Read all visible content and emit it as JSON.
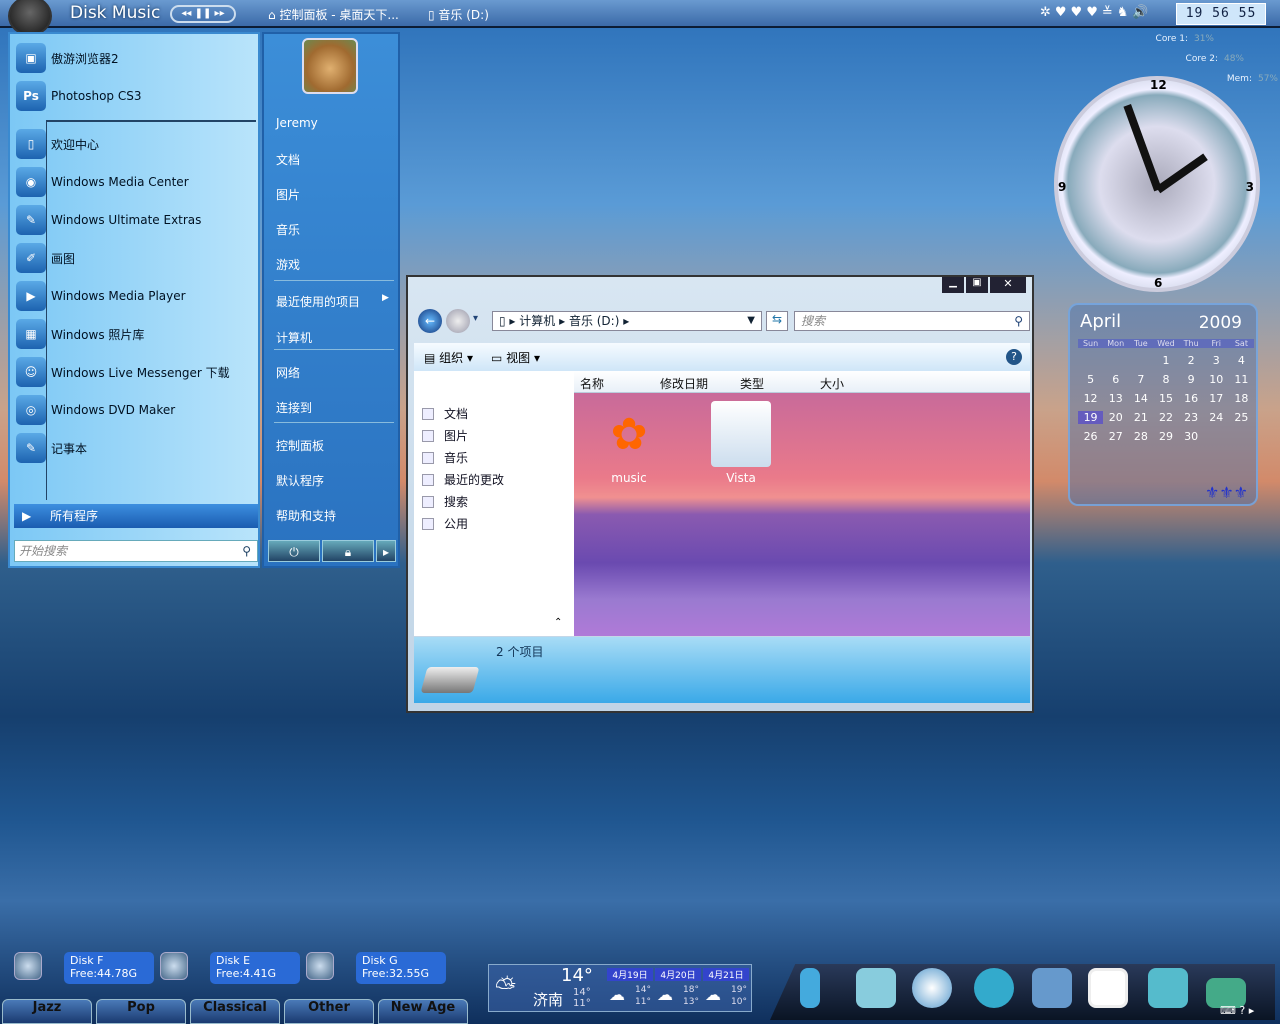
{
  "topbar": {
    "app_name": "Disk  Music",
    "media_controls": "◂◂ ❚❚ ▸▸",
    "tasks": [
      "控制面板 - 桌面天下...",
      "音乐 (D:)"
    ],
    "time": "19 56 55"
  },
  "meters": [
    {
      "label": "Core 1:",
      "value": "31%"
    },
    {
      "label": "Core 2:",
      "value": "48%"
    },
    {
      "label": "Mem:",
      "value": "57%"
    }
  ],
  "start_menu": {
    "pinned": [
      {
        "label": "傲游浏览器2",
        "icon": "browser-icon",
        "glyph": "▣"
      },
      {
        "label": "Photoshop CS3",
        "icon": "photoshop-icon",
        "glyph": "Ps"
      }
    ],
    "recent": [
      {
        "label": "欢迎中心",
        "glyph": "▯"
      },
      {
        "label": "Windows Media Center",
        "glyph": "◉"
      },
      {
        "label": "Windows Ultimate Extras",
        "glyph": "✎"
      },
      {
        "label": "画图",
        "glyph": "✐"
      },
      {
        "label": "Windows Media Player",
        "glyph": "▶"
      },
      {
        "label": "Windows 照片库",
        "glyph": "▦"
      },
      {
        "label": "Windows Live Messenger 下载",
        "glyph": "☺"
      },
      {
        "label": "Windows DVD Maker",
        "glyph": "◎"
      },
      {
        "label": "记事本",
        "glyph": "✎"
      }
    ],
    "all_programs": "所有程序",
    "search_placeholder": "开始搜索",
    "right": [
      "Jeremy",
      "文档",
      "图片",
      "音乐",
      "游戏",
      "最近使用的项目",
      "计算机",
      "网络",
      "连接到",
      "控制面板",
      "默认程序",
      "帮助和支持"
    ]
  },
  "explorer": {
    "breadcrumb": [
      "计算机",
      "音乐 (D:)"
    ],
    "search_placeholder": "搜索",
    "toolbar": [
      "组织",
      "视图"
    ],
    "nav": [
      "文档",
      "图片",
      "音乐",
      "最近的更改",
      "搜索",
      "公用"
    ],
    "columns": [
      "名称",
      "修改日期",
      "类型",
      "大小"
    ],
    "files": [
      "music",
      "Vista"
    ],
    "status": "2 个项目"
  },
  "calendar": {
    "month": "April",
    "year": "2009",
    "weekdays": [
      "Sun",
      "Mon",
      "Tue",
      "Wed",
      "Thu",
      "Fri",
      "Sat"
    ],
    "first_weekday": 3,
    "days": 30,
    "today": 19
  },
  "clock": {
    "numerals": [
      "12",
      "3",
      "6",
      "9"
    ]
  },
  "disks": [
    {
      "name": "Disk F",
      "free": "Free:44.78G"
    },
    {
      "name": "Disk E",
      "free": "Free:4.41G"
    },
    {
      "name": "Disk G",
      "free": "Free:32.55G"
    }
  ],
  "genres": [
    "Jazz",
    "Pop",
    "Classical",
    "Other",
    "New Age"
  ],
  "weather": {
    "city": "济南",
    "temp": "14°",
    "high": "14°",
    "low": "11°",
    "forecast": [
      {
        "date": "4月19日",
        "high": "14°",
        "low": "11°"
      },
      {
        "date": "4月20日",
        "high": "18°",
        "low": "13°"
      },
      {
        "date": "4月21日",
        "high": "19°",
        "low": "10°"
      }
    ]
  }
}
